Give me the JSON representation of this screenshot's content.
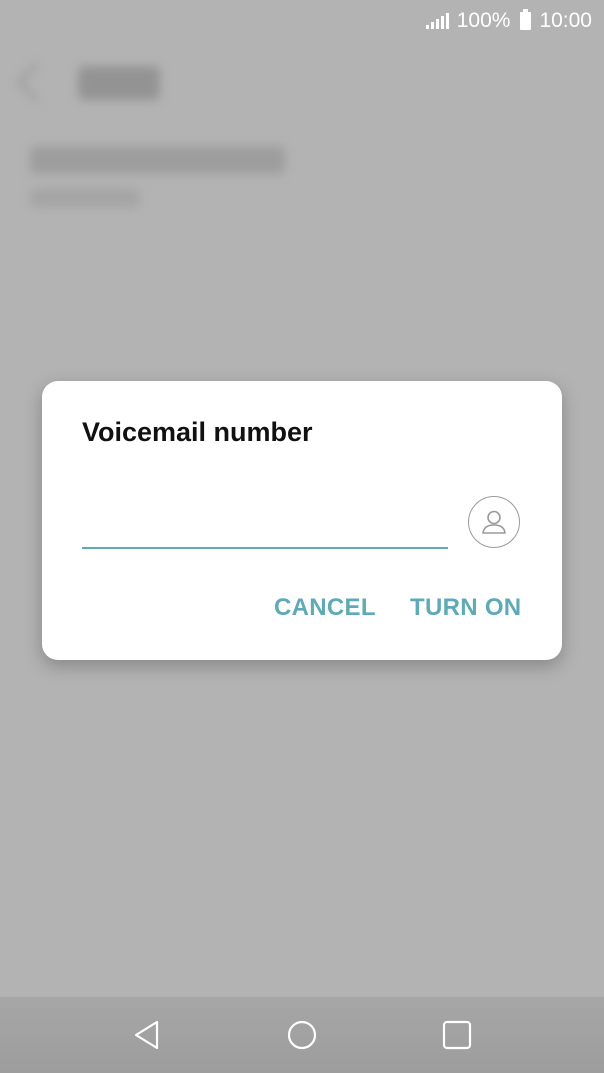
{
  "status_bar": {
    "battery": "100%",
    "time": "10:00"
  },
  "dialog": {
    "title": "Voicemail number",
    "input_value": "",
    "cancel_label": "CANCEL",
    "confirm_label": "TURN ON"
  },
  "icons": {
    "contact": "contact-person-icon",
    "back": "back-triangle-icon",
    "home": "home-circle-icon",
    "recent": "recent-apps-square-icon"
  },
  "colors": {
    "accent": "#5faab7",
    "scrim": "#b3b3b3",
    "dialog_bg": "#ffffff"
  }
}
